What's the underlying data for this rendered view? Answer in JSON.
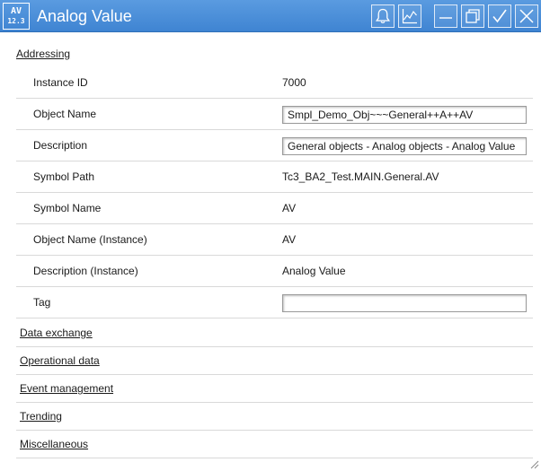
{
  "window": {
    "badge_line1": "AV",
    "badge_line2": "12.3",
    "title": "Analog Value",
    "accent_color": "#4a8fd9"
  },
  "toolbar": {
    "icons": [
      "bell-icon",
      "chart-icon",
      "minimize-icon",
      "restore-icon",
      "check-icon",
      "close-icon"
    ]
  },
  "addressing": {
    "heading": "Addressing",
    "rows": [
      {
        "label": "Instance ID",
        "value": "7000"
      },
      {
        "label": "Object Name",
        "value": "Smpl_Demo_Obj~~~General++A++AV"
      },
      {
        "label": "Description",
        "value": "General objects - Analog objects - Analog Value"
      },
      {
        "label": "Symbol Path",
        "value": "Tc3_BA2_Test.MAIN.General.AV"
      },
      {
        "label": "Symbol Name",
        "value": "AV"
      },
      {
        "label": "Object Name (Instance)",
        "value": "AV"
      },
      {
        "label": "Description (Instance)",
        "value": "Analog Value"
      },
      {
        "label": "Tag",
        "value": ""
      }
    ]
  },
  "sections": [
    {
      "label": "Data exchange"
    },
    {
      "label": "Operational data"
    },
    {
      "label": "Event management"
    },
    {
      "label": "Trending"
    },
    {
      "label": "Miscellaneous"
    }
  ]
}
